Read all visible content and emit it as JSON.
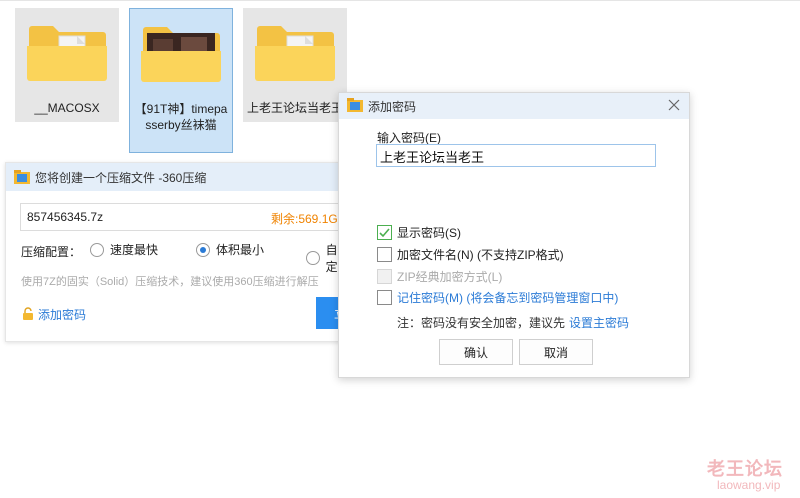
{
  "folders": [
    {
      "label": "__MACOSX",
      "selected": false
    },
    {
      "label": "【91T神】timepasserby丝袜猫",
      "selected": true
    },
    {
      "label": "上老王论坛当老王",
      "selected": false
    }
  ],
  "zip_window": {
    "title": "您将创建一个压缩文件 -360压缩",
    "filename": "857456345.7z",
    "remaining": "剩余:569.1GB",
    "config_label": "压缩配置：",
    "options": [
      {
        "label": "速度最快",
        "selected": false
      },
      {
        "label": "体积最小",
        "selected": true
      },
      {
        "label": "自定",
        "selected": false
      }
    ],
    "hint": "使用7Z的固实（Solid）压缩技术，建议使用360压缩进行解压",
    "add_password": "添加密码",
    "go_button": "立"
  },
  "password_dialog": {
    "title": "添加密码",
    "input_label": "输入密码(E)",
    "password_value": "上老王论坛当老王",
    "checkboxes": [
      {
        "label": "显示密码(S)",
        "checked": true,
        "disabled": false,
        "link": false
      },
      {
        "label": "加密文件名(N) (不支持ZIP格式)",
        "checked": false,
        "disabled": false,
        "link": false
      },
      {
        "label": "ZIP经典加密方式(L)",
        "checked": false,
        "disabled": true,
        "link": false
      },
      {
        "label": "记住密码(M) (将会备忘到密码管理窗口中)",
        "checked": false,
        "disabled": false,
        "link": true
      }
    ],
    "note": "注：密码没有安全加密，建议先",
    "note_link": "设置主密码",
    "ok": "确认",
    "cancel": "取消"
  },
  "watermark": {
    "line1": "老王论坛",
    "line2": "laowang.vip"
  },
  "colors": {
    "accent": "#2b7bd6",
    "orange": "#f08300",
    "selection_bg": "#cce3f7",
    "check_green": "#4caf50"
  }
}
